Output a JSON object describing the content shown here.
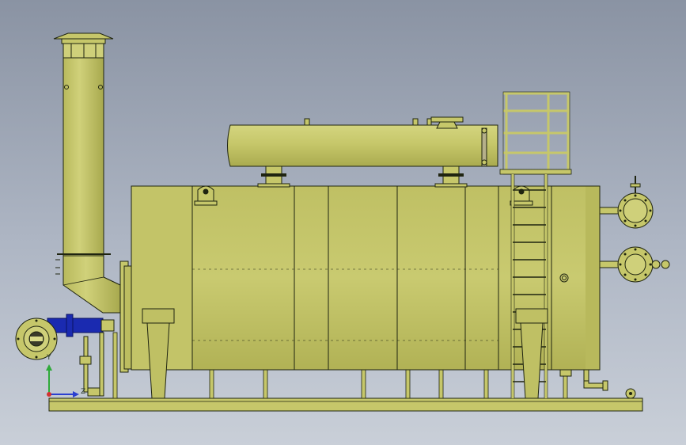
{
  "colors": {
    "background_top": "#8a93a3",
    "background_bottom": "#c9cfd8",
    "part_fill": "#c6c76a",
    "part_shade": "#a9aa4f",
    "part_highlight": "#dadb8a",
    "edge": "#1f2410",
    "valve_blue": "#1a2ab0",
    "triad_x": "#d23232",
    "triad_y": "#2faa3a",
    "triad_z": "#2c3fd0"
  },
  "icons": {
    "triad": "coordinate-triad-icon"
  },
  "triad": {
    "y_label": "Y",
    "x_label": "Z"
  }
}
